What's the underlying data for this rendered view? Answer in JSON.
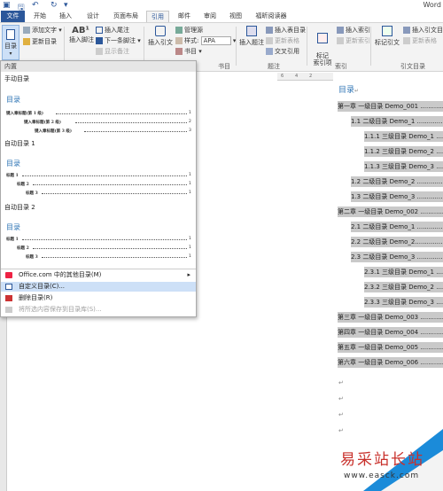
{
  "app": {
    "title": "Word"
  },
  "tabs": [
    "文件",
    "开始",
    "插入",
    "设计",
    "页面布局",
    "引用",
    "邮件",
    "审阅",
    "视图",
    "福昕阅读器"
  ],
  "ribbon": {
    "toc_button": "目录",
    "add_text": "添加文字",
    "update_toc": "更新目录",
    "insert_footnote": "插入脚注",
    "insert_endnote": "插入尾注",
    "next_footnote": "下一条脚注",
    "show_notes": "显示备注",
    "insert_citation": "插入引文",
    "manage_sources": "管理源",
    "style_label": "样式:",
    "style_value": "APA",
    "bibliography": "书目",
    "citations_group": "书目",
    "insert_caption": "插入题注",
    "insert_table_figures": "插入表目录",
    "update_table": "更新表格",
    "cross_reference": "交叉引用",
    "captions_group": "题注",
    "mark_entry": "标记\n索引项",
    "insert_index": "插入索引",
    "update_index": "更新索引",
    "index_group": "索引",
    "mark_citation": "标记引文",
    "insert_toa": "插入引文目录",
    "update_toa": "更新表格",
    "toa_group": "引文目录"
  },
  "menu": {
    "sec_builtin": "内置",
    "manual_title": "手动目录",
    "manual_preview": {
      "title": "目录",
      "lines": [
        "键入章标题(第 1 级)",
        "键入章标题(第 2 级)",
        "键入章标题(第 3 级)"
      ],
      "nums": [
        "1",
        "2",
        "3"
      ]
    },
    "auto1_title": "自动目录 1",
    "auto1_preview": {
      "title": "目录",
      "lines": [
        "标题 1",
        "标题 2",
        "标题 3"
      ],
      "nums": [
        "1",
        "1",
        "1"
      ]
    },
    "auto2_title": "自动目录 2",
    "auto2_preview": {
      "title": "目录",
      "lines": [
        "标题 1",
        "标题 2",
        "标题 3"
      ],
      "nums": [
        "1",
        "1",
        "1"
      ]
    },
    "items": [
      {
        "label": "Office.com 中的其他目录(M)",
        "disabled": false,
        "highlight": false
      },
      {
        "label": "自定义目录(C)...",
        "disabled": false,
        "highlight": true
      },
      {
        "label": "删除目录(R)",
        "disabled": false,
        "highlight": false
      },
      {
        "label": "将所选内容保存到目录库(S)...",
        "disabled": true,
        "highlight": false
      }
    ]
  },
  "ruler": {
    "ticks": [
      "6",
      "4",
      "2",
      "",
      "2",
      "4",
      "6",
      "8",
      "10",
      "1"
    ]
  },
  "document": {
    "toc_title": "目录",
    "rows": [
      {
        "level": 1,
        "text": "第一章  一级目录 Demo_001 ............"
      },
      {
        "level": 2,
        "text": "1.1  二级目录 Demo_1 ..............."
      },
      {
        "level": 3,
        "text": "1.1.1  三级目录 Demo_1 .........."
      },
      {
        "level": 3,
        "text": "1.1.2  三级目录 Demo_2 .........."
      },
      {
        "level": 3,
        "text": "1.1.3  三级目录 Demo_3 .........."
      },
      {
        "level": 2,
        "text": "1.2  二级目录 Demo_2 ..............."
      },
      {
        "level": 2,
        "text": "1.3  二级目录 Demo_3 ..............."
      },
      {
        "level": 1,
        "text": "第二章  一级目录 Demo_002 ............"
      },
      {
        "level": 2,
        "text": "2.1 二级目录 Demo_1 ................"
      },
      {
        "level": 2,
        "text": "2.2 二级目录 Demo_2..............."
      },
      {
        "level": 2,
        "text": "2.3 二级目录 Demo_3 ................"
      },
      {
        "level": 3,
        "text": "2.3.1 三级目录 Demo_1 .........."
      },
      {
        "level": 3,
        "text": "2.3.2 三级目录 Demo_2 .........."
      },
      {
        "level": 3,
        "text": "2.3.3 三级目录 Demo_3 .........."
      },
      {
        "level": 1,
        "text": "第三章  一级目录 Demo_003 ............"
      },
      {
        "level": 1,
        "text": "第四章  一级目录 Demo_004 ............"
      },
      {
        "level": 1,
        "text": "第五章  一级目录 Demo_005 ............"
      },
      {
        "level": 1,
        "text": "第六章  一级目录 Demo_006 ............"
      }
    ],
    "para_mark": "↵"
  },
  "watermark": {
    "text": "易采站长站",
    "url": "www.easck.com"
  },
  "colors": {
    "accent": "#2b579a",
    "heading": "#2e74b5",
    "highlight": "#c9c9c9"
  }
}
